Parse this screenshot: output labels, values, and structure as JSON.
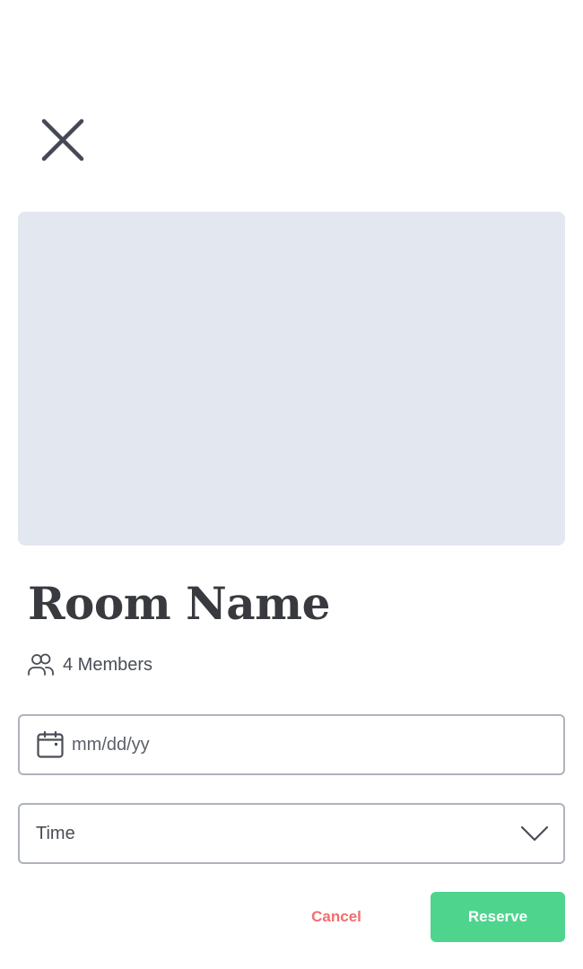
{
  "header": {
    "close_icon": "close-icon"
  },
  "room": {
    "image_placeholder_color": "#e3e7ef",
    "name": "Room Name",
    "members_icon": "users-icon",
    "members_text": "4 Members"
  },
  "form": {
    "date": {
      "icon": "calendar-icon",
      "placeholder": "mm/dd/yy",
      "value": ""
    },
    "time": {
      "label": "Time",
      "icon": "chevron-down-icon"
    }
  },
  "actions": {
    "cancel_label": "Cancel",
    "reserve_label": "Reserve"
  },
  "colors": {
    "accent": "#4fd48e",
    "danger": "#f46d6d",
    "text": "#383a3f",
    "border": "#aeb3bc"
  }
}
